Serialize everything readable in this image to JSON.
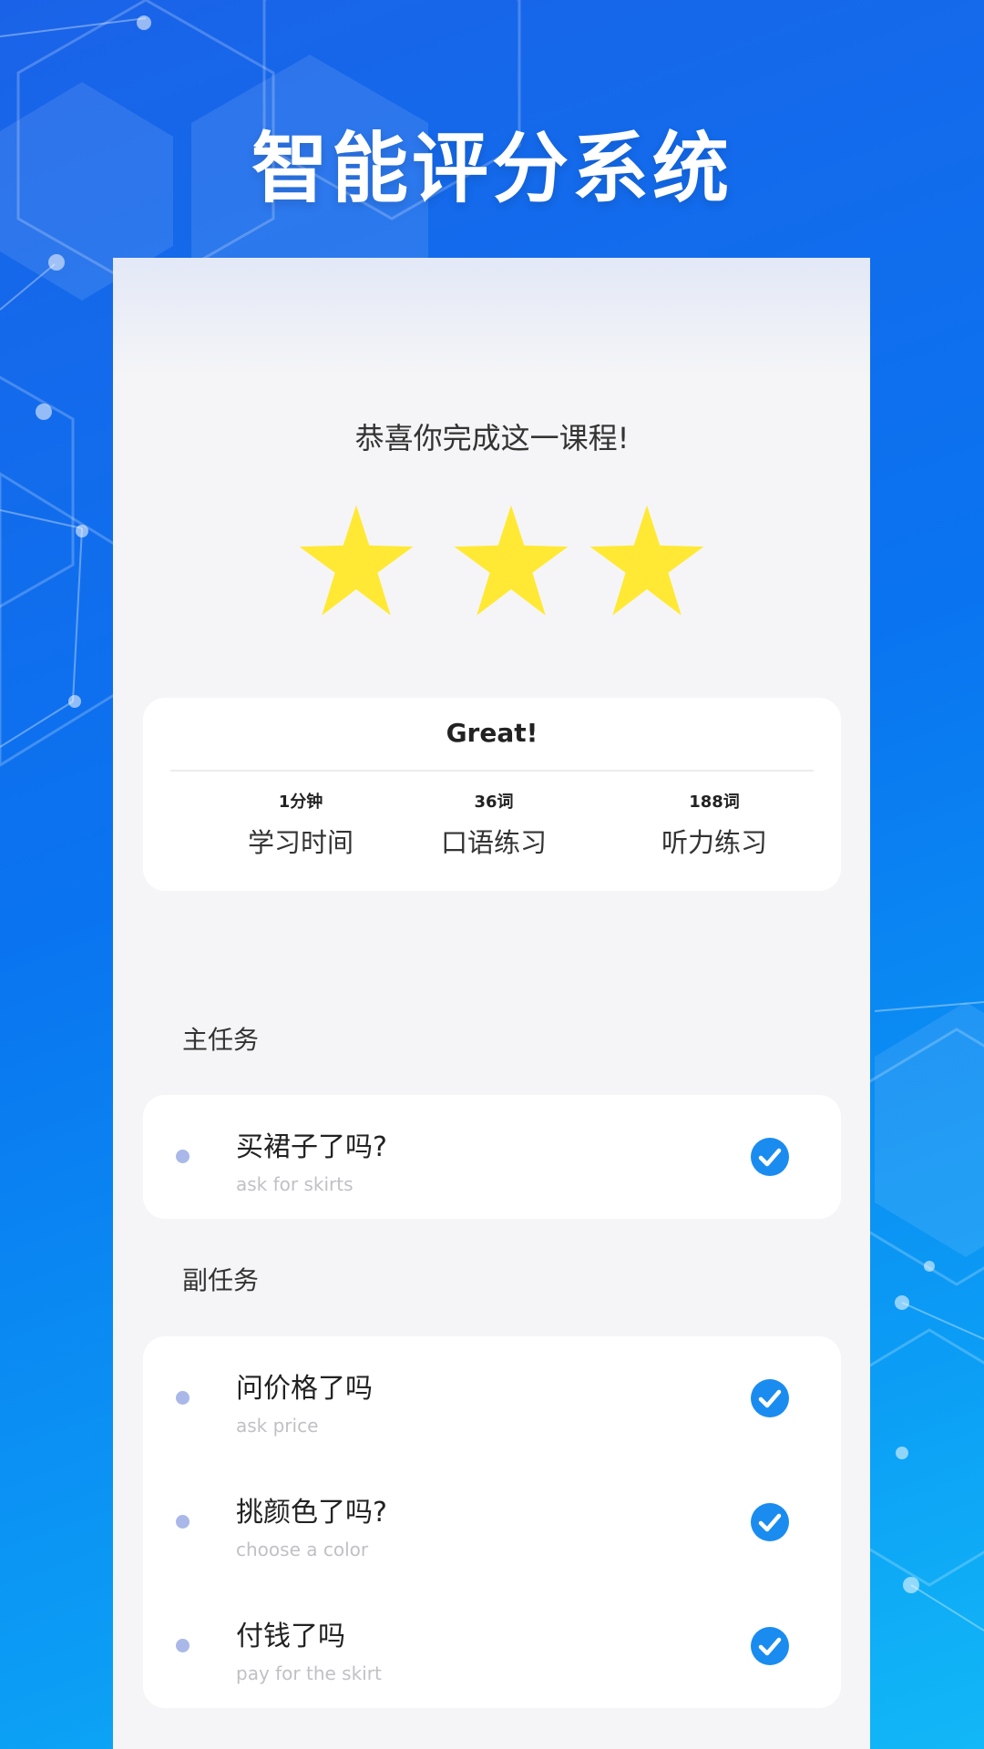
{
  "app": {
    "headline": "智能评分系统",
    "accent_color": "#1a8cf0",
    "star_color": "#ffe934"
  },
  "result": {
    "congrats": "恭喜你完成这一课程!",
    "stars_earned": 3,
    "stars_total": 3,
    "rating": "Great!",
    "stats": [
      {
        "value": "1分钟",
        "label": "学习时间"
      },
      {
        "value": "36词",
        "label": "口语练习"
      },
      {
        "value": "188词",
        "label": "听力练习"
      }
    ]
  },
  "main_tasks": {
    "title": "主任务",
    "items": [
      {
        "title": "买裙子了吗?",
        "subtitle": "ask for skirts",
        "done": true
      }
    ]
  },
  "side_tasks": {
    "title": "副任务",
    "items": [
      {
        "title": "问价格了吗",
        "subtitle": "ask price",
        "done": true
      },
      {
        "title": "挑颜色了吗?",
        "subtitle": "choose a color",
        "done": true
      },
      {
        "title": "付钱了吗",
        "subtitle": "pay for the skirt",
        "done": true
      }
    ]
  }
}
